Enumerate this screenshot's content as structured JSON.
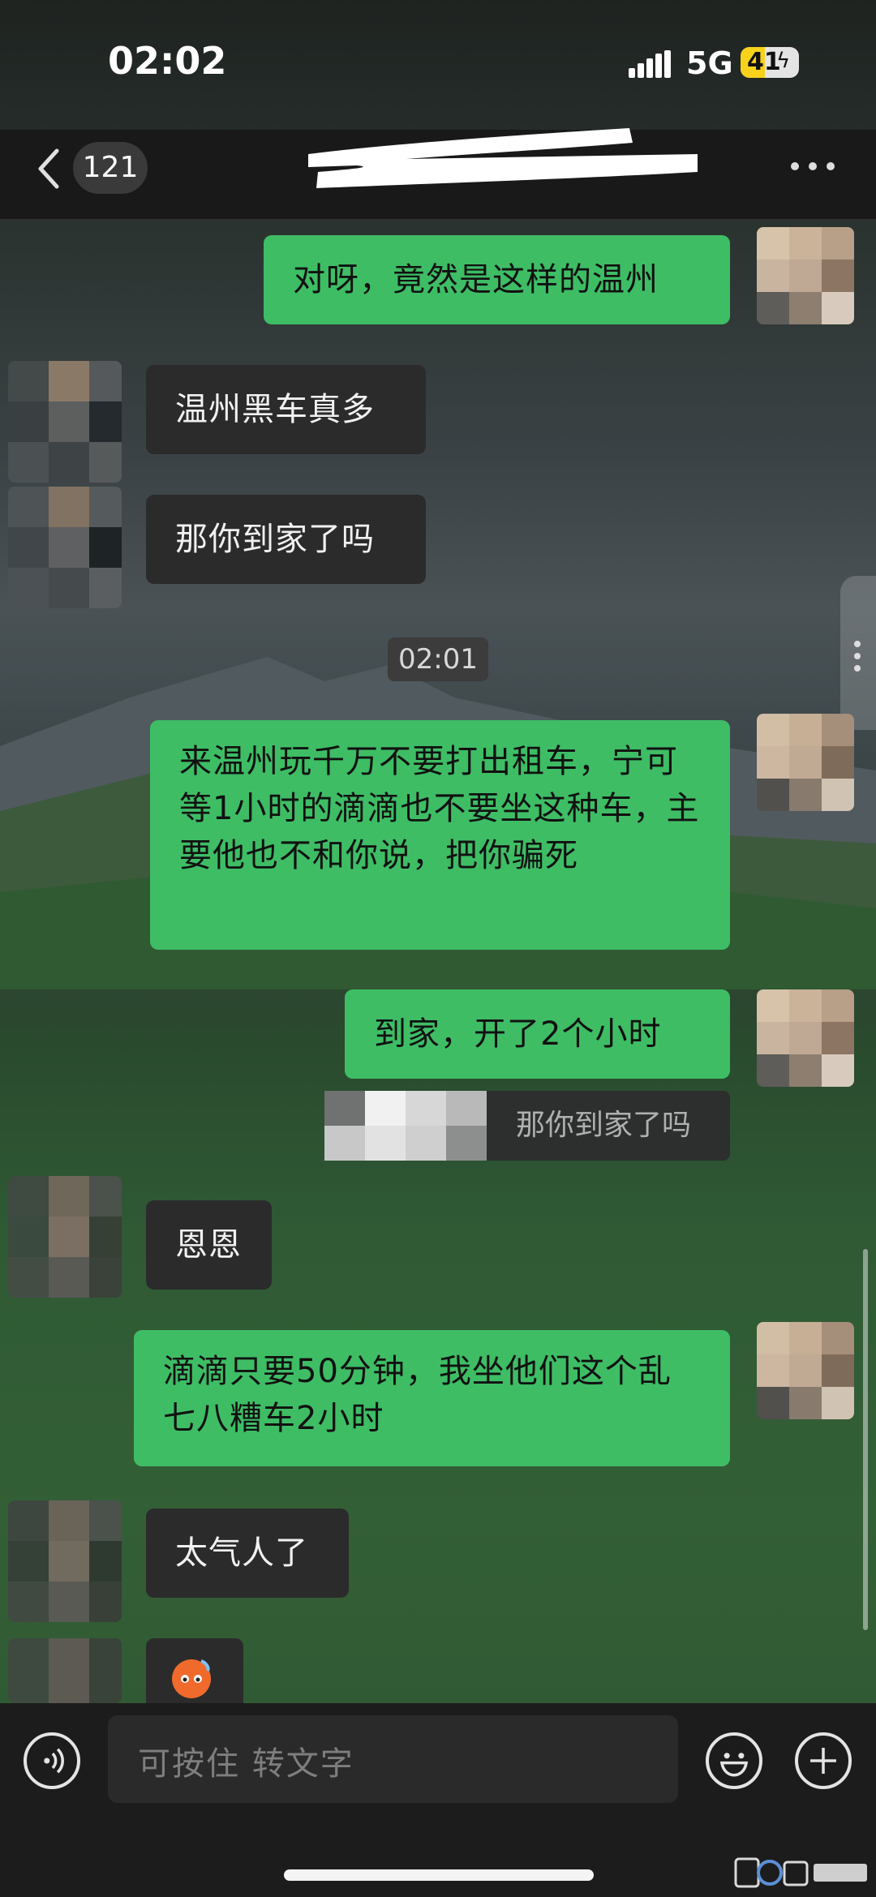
{
  "status_bar": {
    "time": "02:02",
    "network": "5G",
    "battery_level": "41",
    "battery_color": "#f7d21b"
  },
  "header": {
    "unread_count": "121"
  },
  "colors": {
    "my_bubble": "#3ebd65",
    "other_bubble": "#2b2b2b"
  },
  "messages": [
    {
      "side": "me",
      "text": "对呀，竟然是这样的温州"
    },
    {
      "side": "other",
      "text": "温州黑车真多"
    },
    {
      "side": "other",
      "text": "那你到家了吗"
    },
    {
      "side": "me",
      "text": "来温州玩千万不要打出租车，宁可等1小时的滴滴也不要坐这种车，主要他也不和你说，把你骗死"
    },
    {
      "side": "me",
      "text": "到家，开了2个小时"
    },
    {
      "side": "other",
      "text": "恩恩"
    },
    {
      "side": "me",
      "text": "滴滴只要50分钟，我坐他们这个乱七八糟车2小时"
    },
    {
      "side": "other",
      "text": "太气人了"
    }
  ],
  "timestamp": "02:01",
  "quote": {
    "text": "那你到家了吗"
  },
  "input": {
    "placeholder": "可按住 转文字"
  }
}
